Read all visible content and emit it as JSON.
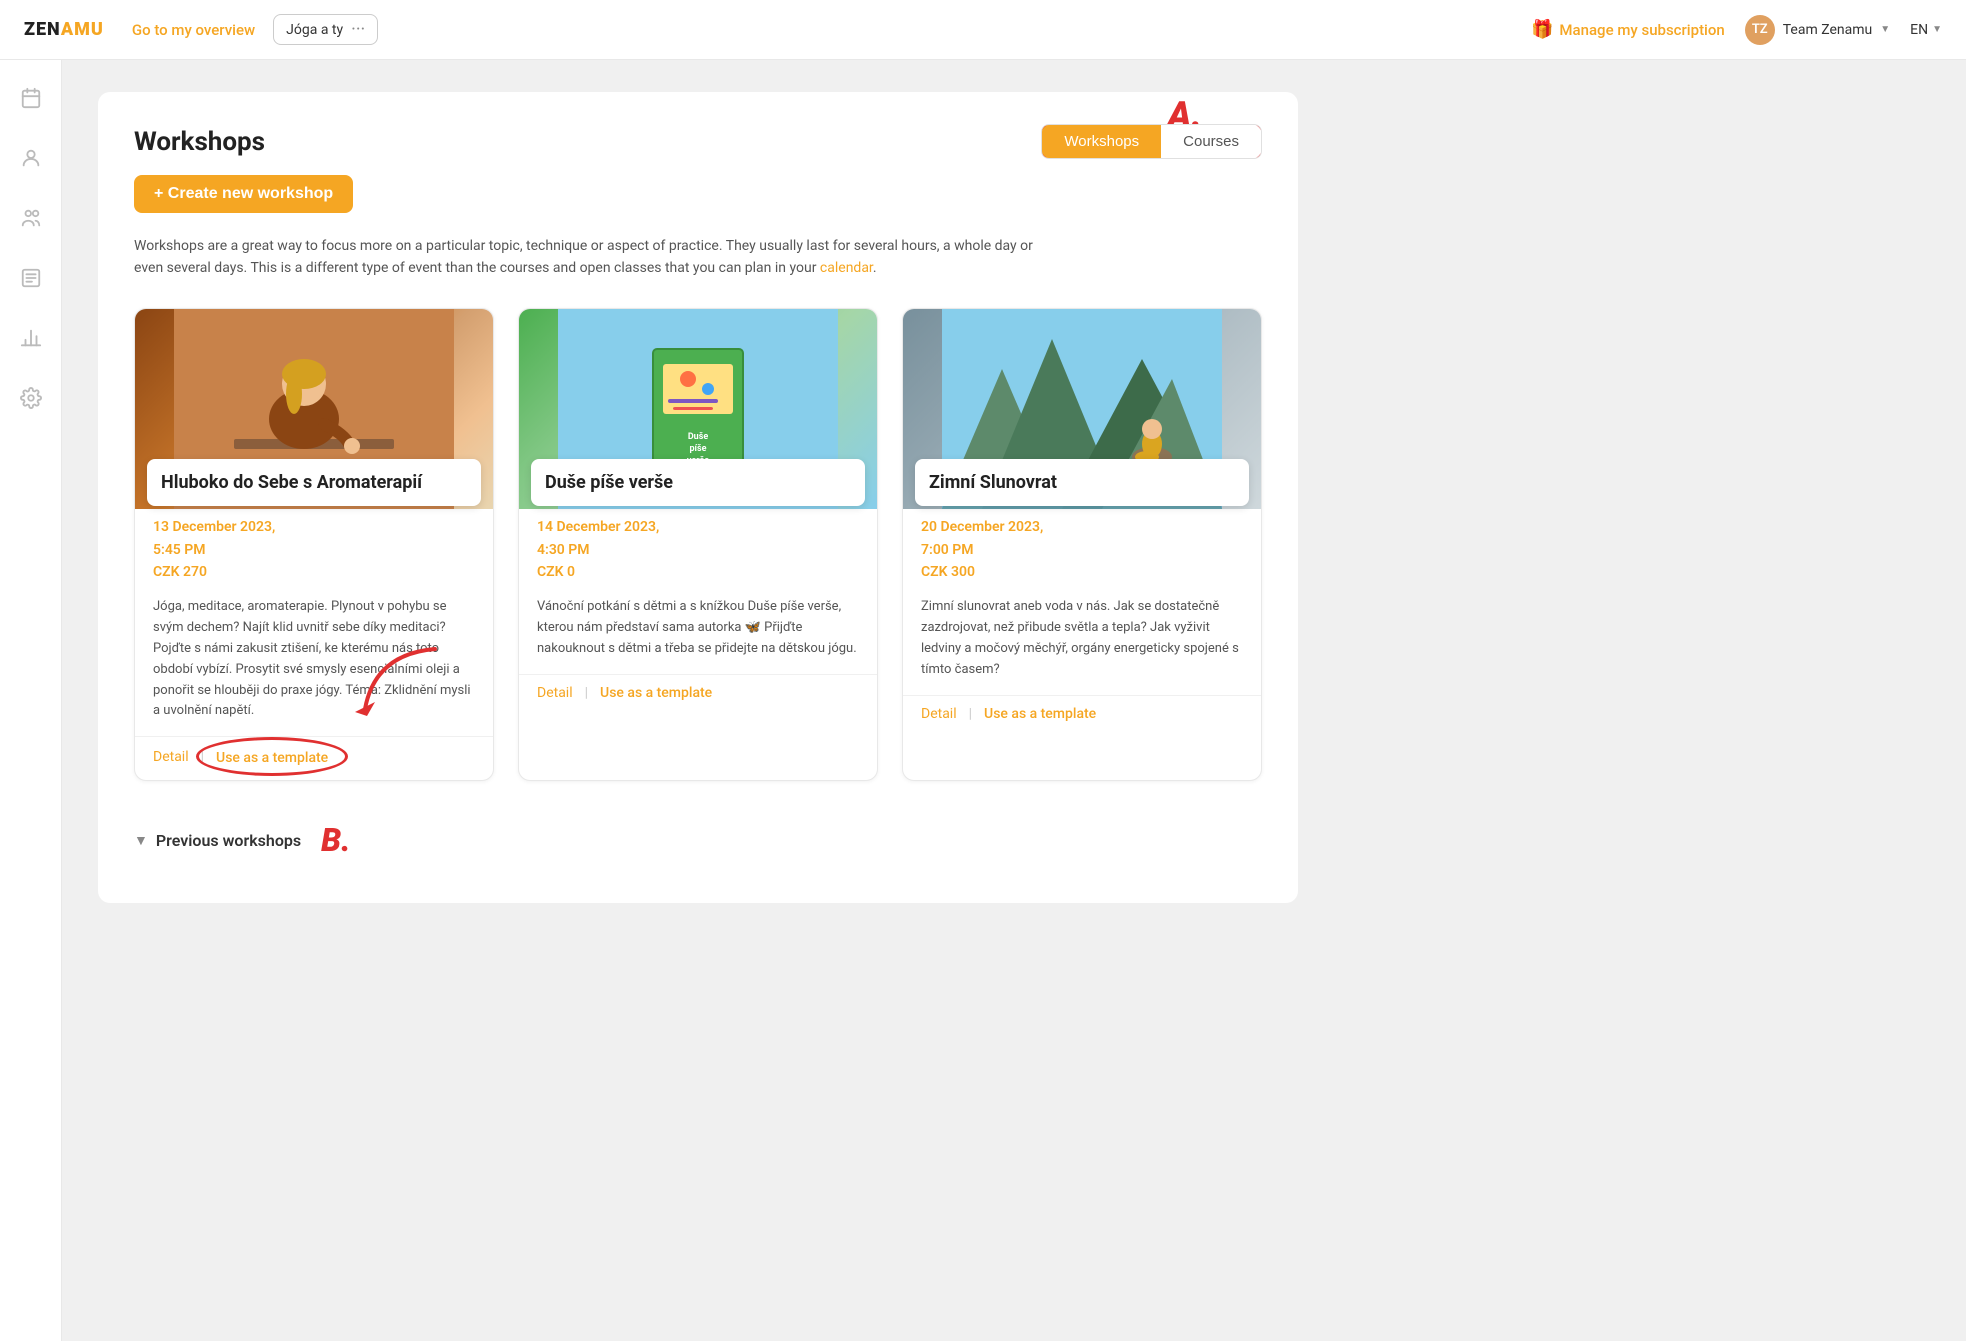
{
  "topnav": {
    "logo": "ZENAMU",
    "overview_label": "Go to my overview",
    "workspace_name": "Jóga a ty",
    "workspace_dots": "···",
    "subscription_label": "Manage my subscription",
    "user_name": "Team Zenamu",
    "lang": "EN"
  },
  "sidebar": {
    "icons": [
      {
        "id": "calendar-icon",
        "symbol": "📅",
        "active": false
      },
      {
        "id": "person-icon",
        "symbol": "🧘",
        "active": false
      },
      {
        "id": "group-icon",
        "symbol": "👥",
        "active": false
      },
      {
        "id": "list-icon",
        "symbol": "📋",
        "active": false
      },
      {
        "id": "chart-icon",
        "symbol": "📊",
        "active": false
      },
      {
        "id": "settings-icon",
        "symbol": "⚙️",
        "active": false
      }
    ]
  },
  "page": {
    "title": "Workshops",
    "create_button": "+ Create new workshop",
    "tabs": [
      {
        "label": "Workshops",
        "active": true
      },
      {
        "label": "Courses",
        "active": false
      }
    ],
    "description": "Workshops are a great way to focus more on a particular topic, technique or aspect of practice. They usually last for several hours, a whole day or even several days. This is a different type of event than the courses and open classes that you can plan in your",
    "calendar_link": "calendar",
    "description_end": ".",
    "annotation_a": "A.",
    "annotation_b": "B.",
    "workshops": [
      {
        "id": "workshop-1",
        "title": "Hluboko do Sebe s Aromaterapií",
        "date": "13 December 2023,\n5:45 PM",
        "price": "CZK 270",
        "description": "Jóga, meditace, aromaterapie. Plynout v pohybu se svým dechem? Najít klid uvnitř sebe díky meditaci? Pojďte s námi zakusit ztišení, ke kterému nás toto období vybízí. Prosytit své smysly esenciálními oleji a ponořit se hlouběji do praxe jógy. Téma: Zklidnění mysli a uvolnění napětí.",
        "detail_label": "Detail",
        "template_label": "Use as a template",
        "img_class": "img-placeholder-1"
      },
      {
        "id": "workshop-2",
        "title": "Duše píše verše",
        "date": "14 December 2023,\n4:30 PM",
        "price": "CZK 0",
        "description": "Vánoční potkání s dětmi a s knížkou Duše píše verše, kterou nám představí sama autorka 🦋 Přijďte nakouknout s dětmi a třeba se přidejte na dětskou jógu.",
        "detail_label": "Detail",
        "template_label": "Use as a template",
        "img_class": "img-placeholder-2"
      },
      {
        "id": "workshop-3",
        "title": "Zimní Slunovrat",
        "date": "20 December 2023,\n7:00 PM",
        "price": "CZK 300",
        "description": "Zimní slunovrat aneb voda v nás. Jak se dostatečně zazdrojovat, než přibude světla a tepla? Jak vyživit ledviny a močový měchýř, orgány energeticky spojené s tímto časem?",
        "detail_label": "Detail",
        "template_label": "Use as a template",
        "img_class": "img-placeholder-3"
      }
    ],
    "previous_section_label": "Previous workshops"
  }
}
